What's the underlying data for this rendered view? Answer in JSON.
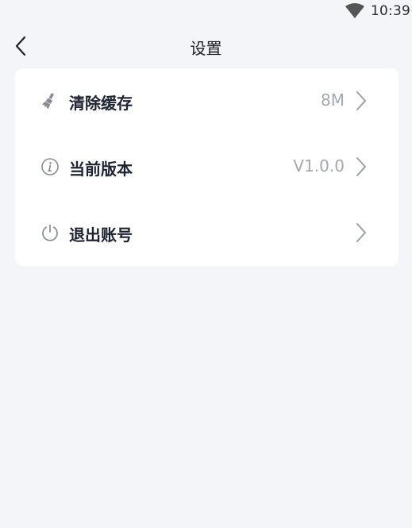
{
  "status_bar": {
    "time": "10:39",
    "icons": [
      "wifi-icon"
    ]
  },
  "nav": {
    "title": "设置",
    "back_icon": "chevron-left-icon"
  },
  "settings": {
    "items": [
      {
        "label": "清除缓存",
        "value": "8M",
        "icon": "broom-icon"
      },
      {
        "label": "当前版本",
        "value": "V1.0.0",
        "icon": "info-icon"
      },
      {
        "label": "退出账号",
        "value": "",
        "icon": "power-icon"
      }
    ]
  },
  "colors": {
    "background": "#f4f5f9",
    "card": "#ffffff",
    "label": "#1d2331",
    "value": "#a4a8b1",
    "icon": "#888c94"
  }
}
